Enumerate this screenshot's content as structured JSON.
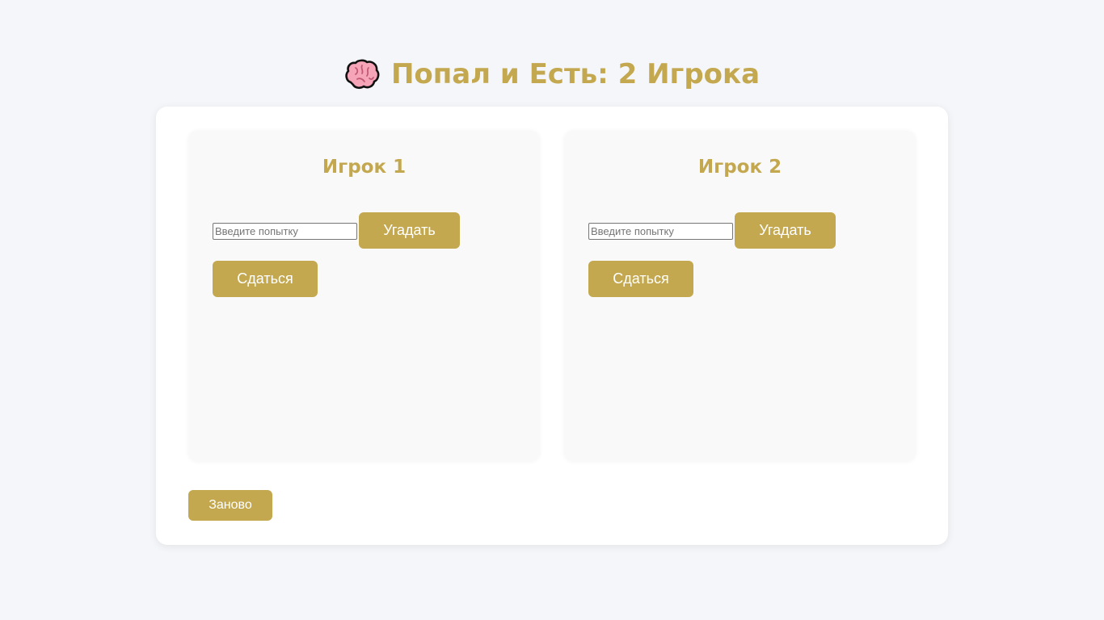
{
  "header": {
    "icon": "brain-icon",
    "title": "Попал и Есть: 2 Игрока"
  },
  "players": [
    {
      "title": "Игрок 1",
      "input_placeholder": "Введите попытку",
      "input_value": "",
      "guess_label": "Угадать",
      "surrender_label": "Сдаться"
    },
    {
      "title": "Игрок 2",
      "input_placeholder": "Введите попытку",
      "input_value": "",
      "guess_label": "Угадать",
      "surrender_label": "Сдаться"
    }
  ],
  "restart_label": "Заново",
  "colors": {
    "accent": "#c4a84f",
    "background": "#f4f6f9",
    "card": "#ffffff",
    "panel": "#f9f9f9"
  }
}
